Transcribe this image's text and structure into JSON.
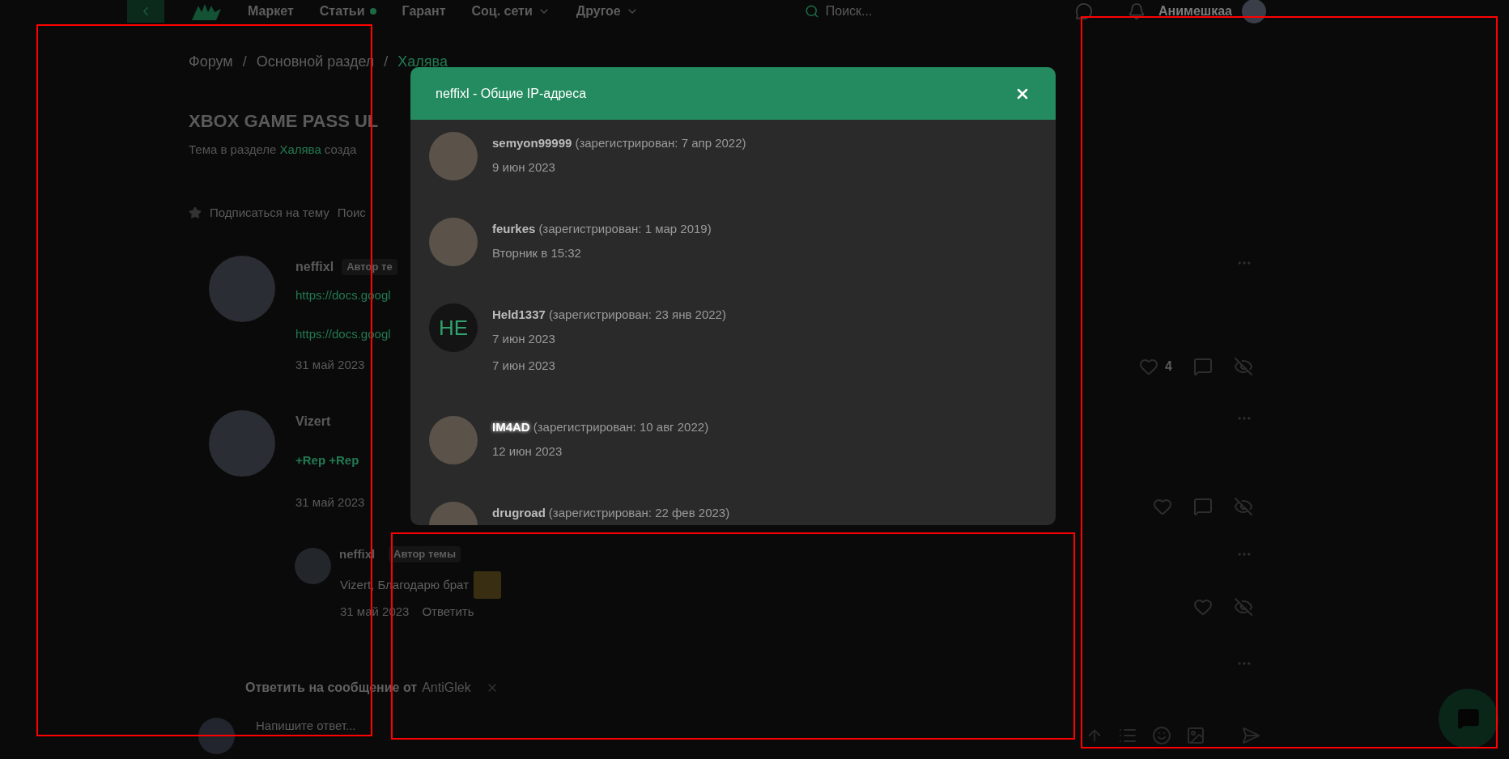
{
  "nav": {
    "items": [
      {
        "label": "Маркет",
        "dot": false,
        "dropdown": false
      },
      {
        "label": "Статьи",
        "dot": true,
        "dropdown": false
      },
      {
        "label": "Гарант",
        "dot": false,
        "dropdown": false
      },
      {
        "label": "Соц. сети",
        "dot": false,
        "dropdown": true
      },
      {
        "label": "Другое",
        "dot": false,
        "dropdown": true
      }
    ],
    "search": {
      "placeholder": "Поиск..."
    },
    "user": {
      "name": "Анимешкаа"
    }
  },
  "breadcrumb": [
    {
      "kind": "link",
      "label": "Форум",
      "current": false
    },
    {
      "kind": "separator",
      "label": "/"
    },
    {
      "kind": "link",
      "label": "Основной раздел",
      "current": false
    },
    {
      "kind": "separator",
      "label": "/"
    },
    {
      "kind": "link",
      "label": "Халява",
      "current": true
    }
  ],
  "thread": {
    "title": "XBOX GAME PASS UL",
    "subtitle_prefix": "Тема в разделе",
    "subtitle_link": "Халява",
    "subtitle_suffix": "созда",
    "actions": [
      "Подписаться на тему",
      "Поис"
    ]
  },
  "posts": [
    {
      "author": "neffixl",
      "badge": "Автор те",
      "lines": [
        {
          "kind": "link",
          "text": "https://docs.googl"
        },
        {
          "kind": "link",
          "text": "https://docs.googl"
        }
      ],
      "date": "31 май 2023"
    },
    {
      "author": "Vizert",
      "lines": [
        {
          "kind": "rep",
          "text": "+Rep +Rep"
        }
      ],
      "date": "31 май 2023"
    }
  ],
  "reply": {
    "author": "neffixl",
    "badge": "Автор темы",
    "mention": "Vizert",
    "text": ", Благодарю брат",
    "date": "31 май 2023",
    "action": "Ответить"
  },
  "side_actions": [
    {
      "kind": "menu"
    },
    {
      "kind": "actions",
      "likes": "4",
      "comment": true
    },
    {
      "kind": "menu"
    },
    {
      "kind": "actions",
      "comment": true
    },
    {
      "kind": "menu"
    },
    {
      "kind": "actions",
      "comment": false
    },
    {
      "kind": "menu"
    }
  ],
  "reply_to": {
    "prefix": "Ответить на сообщение от",
    "author": "AntiGlek"
  },
  "composer": {
    "placeholder": "Напишите ответ..."
  },
  "modal": {
    "title": "neffixl - Общие IP-адреса",
    "users": [
      {
        "name": "semyon99999",
        "registered": "(зарегистрирован: 7 апр 2022)",
        "dates": [
          "9 июн 2023"
        ],
        "kind": "photo",
        "highlighted": false
      },
      {
        "name": "feurkes",
        "registered": "(зарегистрирован: 1 мар 2019)",
        "dates": [
          "Вторник в 15:32"
        ],
        "kind": "photo",
        "highlighted": false
      },
      {
        "name": "Held1337",
        "registered": "(зарегистрирован: 23 янв 2022)",
        "dates": [
          "7 июн 2023",
          "7 июн 2023"
        ],
        "kind": "initials",
        "initials": "HE",
        "highlighted": false
      },
      {
        "name": "IM4AD",
        "registered": "(зарегистрирован: 10 авг 2022)",
        "dates": [
          "12 июн 2023"
        ],
        "kind": "photo",
        "highlighted": true
      },
      {
        "name": "drugroad",
        "registered": "(зарегистрирован: 22 фев 2023)",
        "kind": "photo",
        "highlighted": false
      }
    ]
  }
}
